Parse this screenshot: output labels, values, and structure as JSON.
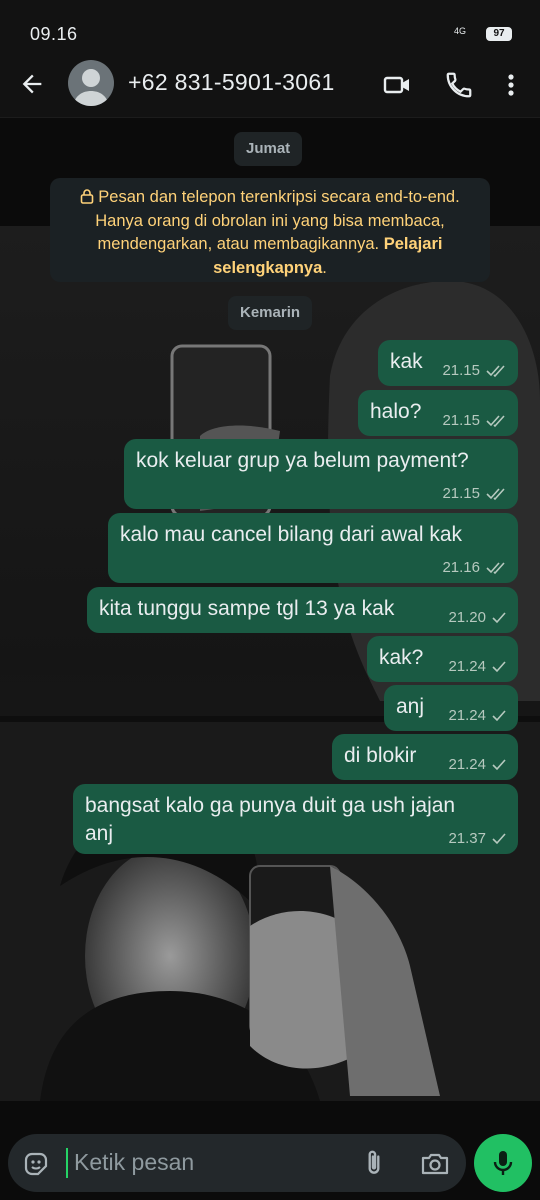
{
  "status": {
    "time": "09.16",
    "network": "4G",
    "battery": "97"
  },
  "header": {
    "contact": "+62 831-5901-3061"
  },
  "chat": {
    "date_chips": [
      "Jumat",
      "Kemarin"
    ],
    "encryption_notice": {
      "text": "Pesan dan telepon terenkripsi secara end-to-end. Hanya orang di obrolan ini yang bisa membaca, mendengarkan, atau membagikannya.",
      "link": "Pelajari selengkapnya",
      "trailing": "."
    },
    "messages": [
      {
        "text": "kak",
        "time": "21.15",
        "status": "read"
      },
      {
        "text": "halo?",
        "time": "21.15",
        "status": "read"
      },
      {
        "text": "kok keluar grup ya belum payment?",
        "time": "21.15",
        "status": "read"
      },
      {
        "text": "kalo mau cancel bilang dari awal kak",
        "time": "21.16",
        "status": "read"
      },
      {
        "text": "kita tunggu sampe tgl 13 ya kak",
        "time": "21.20",
        "status": "sent"
      },
      {
        "text": "kak?",
        "time": "21.24",
        "status": "sent"
      },
      {
        "text": "anj",
        "time": "21.24",
        "status": "sent"
      },
      {
        "text": "di blokir",
        "time": "21.24",
        "status": "sent"
      },
      {
        "text": "bangsat kalo ga punya duit ga ush jajan",
        "text2": "anj",
        "time": "21.37",
        "status": "sent"
      }
    ]
  },
  "composer": {
    "placeholder": "Ketik pesan"
  },
  "colors": {
    "bubble_out": "#1a5a43",
    "accent": "#21c063",
    "notice_text": "#ffd279"
  }
}
